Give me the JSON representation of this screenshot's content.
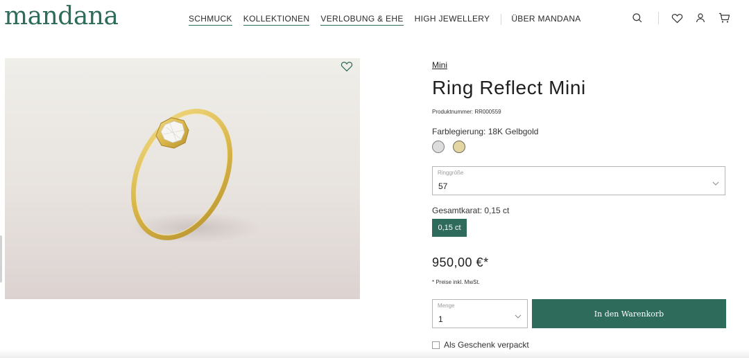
{
  "brand": {
    "logo": "mandana"
  },
  "nav": {
    "items": [
      {
        "label": "SCHMUCK"
      },
      {
        "label": "KOLLEKTIONEN"
      },
      {
        "label": "VERLOBUNG & EHE"
      },
      {
        "label": "HIGH JEWELLERY"
      },
      {
        "label": "ÜBER MANDANA"
      }
    ]
  },
  "header_icons": [
    "search-icon",
    "heart-icon",
    "user-icon",
    "cart-icon"
  ],
  "product": {
    "collection_link": "Mini",
    "title": "Ring Reflect Mini",
    "sku": "Produktnummer: RR000559",
    "color_label": "Farblegierung: 18K Gelbgold",
    "swatch_colors": [
      "#dcdcdc",
      "#e3d6a2"
    ],
    "ring_size": {
      "label": "Ringgröße",
      "value": "57"
    },
    "karat_label": "Gesamtkarat: 0,15 ct",
    "karat_option": "0,15 ct",
    "price": "950,00 €*",
    "price_note": "* Preise inkl. MwSt.",
    "quantity": {
      "label": "Menge",
      "value": "1"
    },
    "add_to_cart": "In den Warenkorb",
    "gift_wrap": "Als Geschenk verpackt"
  },
  "colors": {
    "accent": "#2f6b5b",
    "gold": "#d9b74a"
  }
}
